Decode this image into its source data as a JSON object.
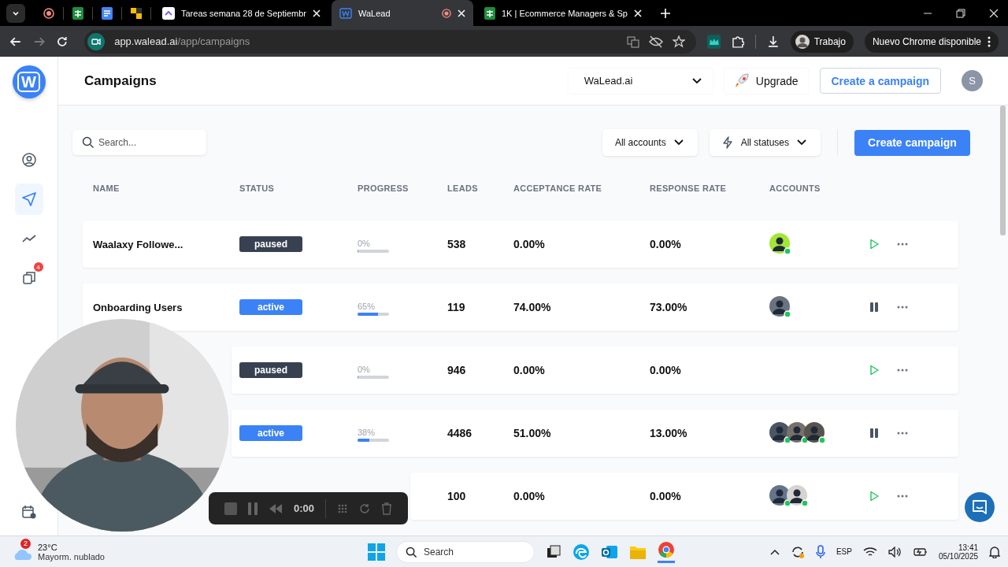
{
  "browser": {
    "tabs": [
      {
        "kind": "record-pin",
        "selected": false
      },
      {
        "kind": "sheet-pin",
        "selected": false
      },
      {
        "kind": "doc-pin",
        "selected": false
      },
      {
        "kind": "tile-pin",
        "selected": false
      },
      {
        "kind": "task-tab",
        "title": "Tareas semana 28 de Septiembr",
        "selected": false
      },
      {
        "kind": "walead-tab",
        "title": "WaLead",
        "recording": true,
        "selected": true
      },
      {
        "kind": "sheet-tab",
        "title": "1K | Ecommerce Managers & Sp",
        "selected": false
      }
    ],
    "forward_disabled": true,
    "url_host": "app.walead.ai",
    "url_path": "/app/campaigns",
    "profile": "Trabajo",
    "update_label": "Nuevo Chrome disponible"
  },
  "sidebar": {
    "logo": "W",
    "items": [
      {
        "kind": "user",
        "selected": false
      },
      {
        "kind": "send",
        "selected": true
      },
      {
        "kind": "trend",
        "selected": false
      },
      {
        "kind": "copy",
        "badge": "4",
        "selected": false
      },
      {
        "kind": "calendar",
        "selected": false
      }
    ]
  },
  "header": {
    "title": "Campaigns",
    "workspace": "WaLead.ai",
    "upgrade": "Upgrade",
    "create_link": "Create a campaign",
    "avatar": "S"
  },
  "toolbar": {
    "search_placeholder": "Search...",
    "accounts_filter": "All accounts",
    "status_filter": "All statuses",
    "create_button": "Create campaign"
  },
  "table": {
    "columns": [
      "NAME",
      "STATUS",
      "PROGRESS",
      "LEADS",
      "ACCEPTANCE RATE",
      "RESPONSE RATE",
      "ACCOUNTS"
    ],
    "rows": [
      {
        "kind": "paused",
        "name": "Waalaxy Followe...",
        "status": "paused",
        "progress": {
          "label": "0%",
          "level": 0
        },
        "leads": "538",
        "acceptance": "0.00%",
        "response": "0.00%",
        "accounts": [
          {
            "color": "#a3e635",
            "online": true
          }
        ]
      },
      {
        "kind": "active",
        "name": "Onboarding Users",
        "status": "active",
        "progress": {
          "label": "65%",
          "level": 0.65
        },
        "leads": "119",
        "acceptance": "74.00%",
        "response": "73.00%",
        "accounts": [
          {
            "color": "#6b7280",
            "online": true
          }
        ]
      },
      {
        "kind": "paused",
        "status": "paused",
        "progress": {
          "label": "0%",
          "level": 0
        },
        "leads": "946",
        "acceptance": "0.00%",
        "response": "0.00%"
      },
      {
        "kind": "active",
        "status": "active",
        "progress": {
          "label": "38%",
          "level": 0.38
        },
        "leads": "4486",
        "acceptance": "51.00%",
        "response": "13.00%",
        "accounts": [
          {
            "color": "#4b5563",
            "online": true
          },
          {
            "color": "#78716c",
            "online": true
          },
          {
            "color": "#57534e",
            "online": true
          }
        ]
      },
      {
        "kind": "paused",
        "leads": "100",
        "acceptance": "0.00%",
        "response": "0.00%",
        "accounts": [
          {
            "color": "#64748b",
            "online": true
          },
          {
            "color": "#d6d3d1",
            "online": true
          }
        ]
      }
    ]
  },
  "recorder": {
    "time": "0:00"
  },
  "taskbar": {
    "weather_badge": "2",
    "temperature": "23°C",
    "weather": "Mayorm. nublado",
    "search_placeholder": "Search",
    "language": "ESP",
    "time": "13:41",
    "date": "05/10/2025"
  }
}
